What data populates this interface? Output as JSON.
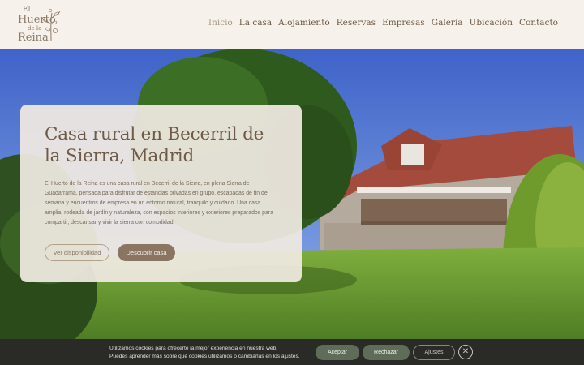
{
  "brand": {
    "line1": "El",
    "line2": "Huerto",
    "line3": "de la",
    "line4": "Reina"
  },
  "nav": {
    "items": [
      {
        "label": "Inicio",
        "active": true
      },
      {
        "label": "La casa"
      },
      {
        "label": "Alojamiento"
      },
      {
        "label": "Reservas"
      },
      {
        "label": "Empresas"
      },
      {
        "label": "Galería"
      },
      {
        "label": "Ubicación"
      },
      {
        "label": "Contacto"
      }
    ]
  },
  "hero": {
    "title": "Casa rural en Becerril de la Sierra, Madrid",
    "description": "El Huerto de la Reina es una casa rural en Becerril de la Sierra, en plena Sierra de Guadarrama, pensada para disfrutar de estancias privadas en grupo, escapadas de fin de semana y encuentros de empresa en un entorno natural, tranquilo y cuidado. Una casa amplia, rodeada de jardín y naturaleza, con espacios interiores y exteriores preparados para compartir, descansar y vivir la sierra con comodidad.",
    "primary_button": "Ver disponibilidad",
    "secondary_button": "Descubrir casa"
  },
  "cookie": {
    "message_line1": "Utilizamos cookies para ofrecerte la mejor experiencia en nuestra web.",
    "message_line2_prefix": "Puedes aprender más sobre qué cookies utilizamos o cambiarlas en los",
    "message_link": "ajustes",
    "message_suffix": ".",
    "accept": "Aceptar",
    "reject": "Rechazar",
    "settings": "Ajustes",
    "close_symbol": "✕"
  },
  "colors": {
    "header_bg": "#f6f1ea",
    "brand_brown": "#6e5a47",
    "button_fill": "#8a7563",
    "cookie_bg": "#2a2a27",
    "cookie_button": "#5f6d58"
  },
  "icons": [
    "tree-logo-icon",
    "close-icon"
  ]
}
